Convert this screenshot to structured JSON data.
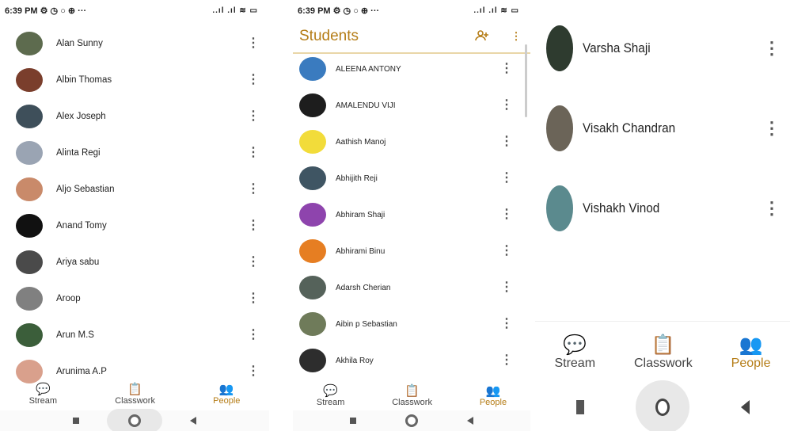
{
  "accent": "#b57d17",
  "panel1": {
    "status": {
      "time": "6:39 PM",
      "left_icons": "⚙ ◷ ○ ⊕ ···",
      "right_icons": "..ıl .ıl ≋ ▭"
    },
    "students": [
      {
        "name": "Alan Sunny",
        "color": "#5d6b4e"
      },
      {
        "name": "Albin Thomas",
        "color": "#7a3e2c"
      },
      {
        "name": "Alex Joseph",
        "color": "#3e4f5a"
      },
      {
        "name": "Alinta Regi",
        "color": "#9aa4b3"
      },
      {
        "name": "Aljo Sebastian",
        "color": "#c98a6a"
      },
      {
        "name": "Anand Tomy",
        "color": "#111111"
      },
      {
        "name": "Ariya sabu",
        "color": "#4a4a4a"
      },
      {
        "name": "Aroop",
        "color": "#808080"
      },
      {
        "name": "Arun M.S",
        "color": "#3b5e3a"
      },
      {
        "name": "Arunima A.P",
        "color": "#d9a08c"
      }
    ],
    "nav": [
      {
        "label": "Stream",
        "icon": "💬",
        "active": false
      },
      {
        "label": "Classwork",
        "icon": "📋",
        "active": false
      },
      {
        "label": "People",
        "icon": "👥",
        "active": true
      }
    ]
  },
  "panel2": {
    "status": {
      "time": "6:39 PM",
      "left_icons": "⚙ ◷ ○ ⊕ ···",
      "right_icons": "..ıl .ıl ≋ ▭"
    },
    "title": "Students",
    "add_icon": "person-add-icon",
    "students": [
      {
        "name": "ALEENA ANTONY",
        "color": "#3a7bbf"
      },
      {
        "name": "AMALENDU VIJI",
        "color": "#1d1d1d"
      },
      {
        "name": "Aathish Manoj",
        "color": "#f2dc3a"
      },
      {
        "name": "Abhijith Reji",
        "color": "#3f5563"
      },
      {
        "name": "Abhiram Shaji",
        "color": "#8e44ad"
      },
      {
        "name": "Abhirami Binu",
        "color": "#e67e22"
      },
      {
        "name": "Adarsh Cherian",
        "color": "#55625a"
      },
      {
        "name": "Aibin p Sebastian",
        "color": "#6f7b5a"
      },
      {
        "name": "Akhila Roy",
        "color": "#2d2d2d"
      }
    ],
    "nav": [
      {
        "label": "Stream",
        "icon": "💬",
        "active": false
      },
      {
        "label": "Classwork",
        "icon": "📋",
        "active": false
      },
      {
        "label": "People",
        "icon": "👥",
        "active": true
      }
    ]
  },
  "panel3": {
    "students": [
      {
        "name": "Varsha Shaji",
        "color": "#2e3b2f"
      },
      {
        "name": "Visakh Chandran",
        "color": "#6b6458"
      },
      {
        "name": "Vishakh Vinod",
        "color": "#5b8a8e"
      }
    ],
    "nav": [
      {
        "label": "Stream",
        "icon": "💬",
        "active": false
      },
      {
        "label": "Classwork",
        "icon": "📋",
        "active": false
      },
      {
        "label": "People",
        "icon": "👥",
        "active": true
      }
    ]
  }
}
